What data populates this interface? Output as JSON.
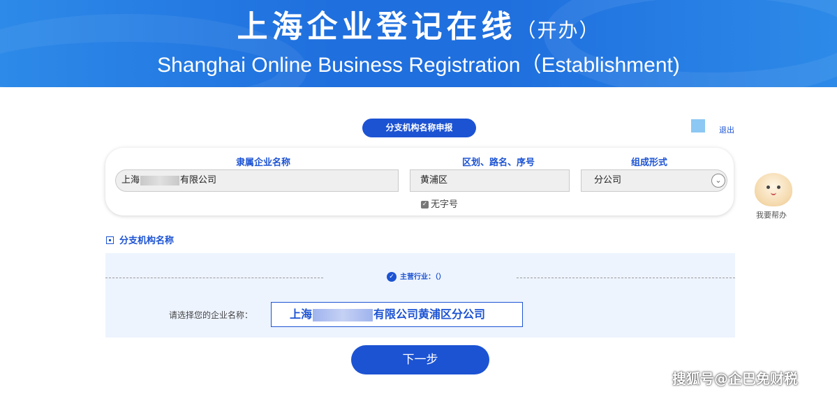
{
  "banner": {
    "title": "上海企业登记在线",
    "title_suffix": "（开办）",
    "subtitle": "Shanghai Online Business Registration（Establishment)"
  },
  "section_pill": "分支机构名称申报",
  "logout": "退出",
  "form": {
    "col1_label": "隶属企业名称",
    "col2_label": "区划、路名、序号",
    "col3_label": "组成形式",
    "parent_name_prefix": "上海",
    "parent_name_suffix": "有限公司",
    "district": "黄浦区",
    "form_type": "分公司",
    "no_name_checkbox": "无字号"
  },
  "mascot_label": "我要帮办",
  "branch_section": {
    "title": "分支机构名称",
    "industry_label": "主营行业：（）",
    "choose_label": "请选择您的企业名称：",
    "name_prefix": "上海",
    "name_suffix": "有限公司黄浦区分公司"
  },
  "next_button": "下一步",
  "watermark": "搜狐号@企巴免财税",
  "colors": {
    "accent": "#1c53d3",
    "banner": "#1f6fde",
    "panel": "#eef4fe"
  }
}
